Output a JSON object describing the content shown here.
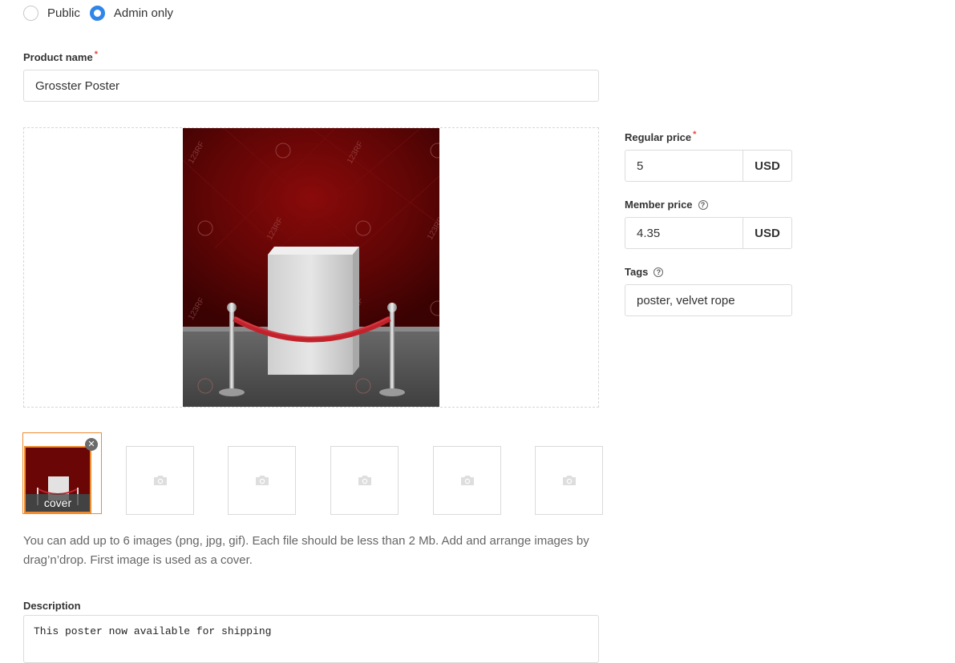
{
  "visibility": {
    "options": [
      {
        "label": "Public",
        "selected": false
      },
      {
        "label": "Admin only",
        "selected": true
      }
    ],
    "accent_color": "#2f86e8"
  },
  "product_name": {
    "label": "Product name",
    "required_mark": "*",
    "value": "Grosster Poster"
  },
  "images": {
    "cover_label": "cover",
    "max_slots": 6,
    "placeholder_icon": "camera-icon",
    "hint": "You can add up to 6 images (png, jpg, gif). Each file should be less than 2 Mb. Add and arrange images by drag’n’drop. First image is used as a cover.",
    "watermark": "123RF",
    "cover_border_color": "#f08a2e"
  },
  "regular_price": {
    "label": "Regular price",
    "required_mark": "*",
    "value": "5",
    "currency": "USD"
  },
  "member_price": {
    "label": "Member price",
    "help_icon": "question-circle-icon",
    "value": "4.35",
    "currency": "USD"
  },
  "tags": {
    "label": "Tags",
    "help_icon": "question-circle-icon",
    "value": "poster, velvet rope"
  },
  "description": {
    "label": "Description",
    "value": "This poster now available for shipping"
  }
}
